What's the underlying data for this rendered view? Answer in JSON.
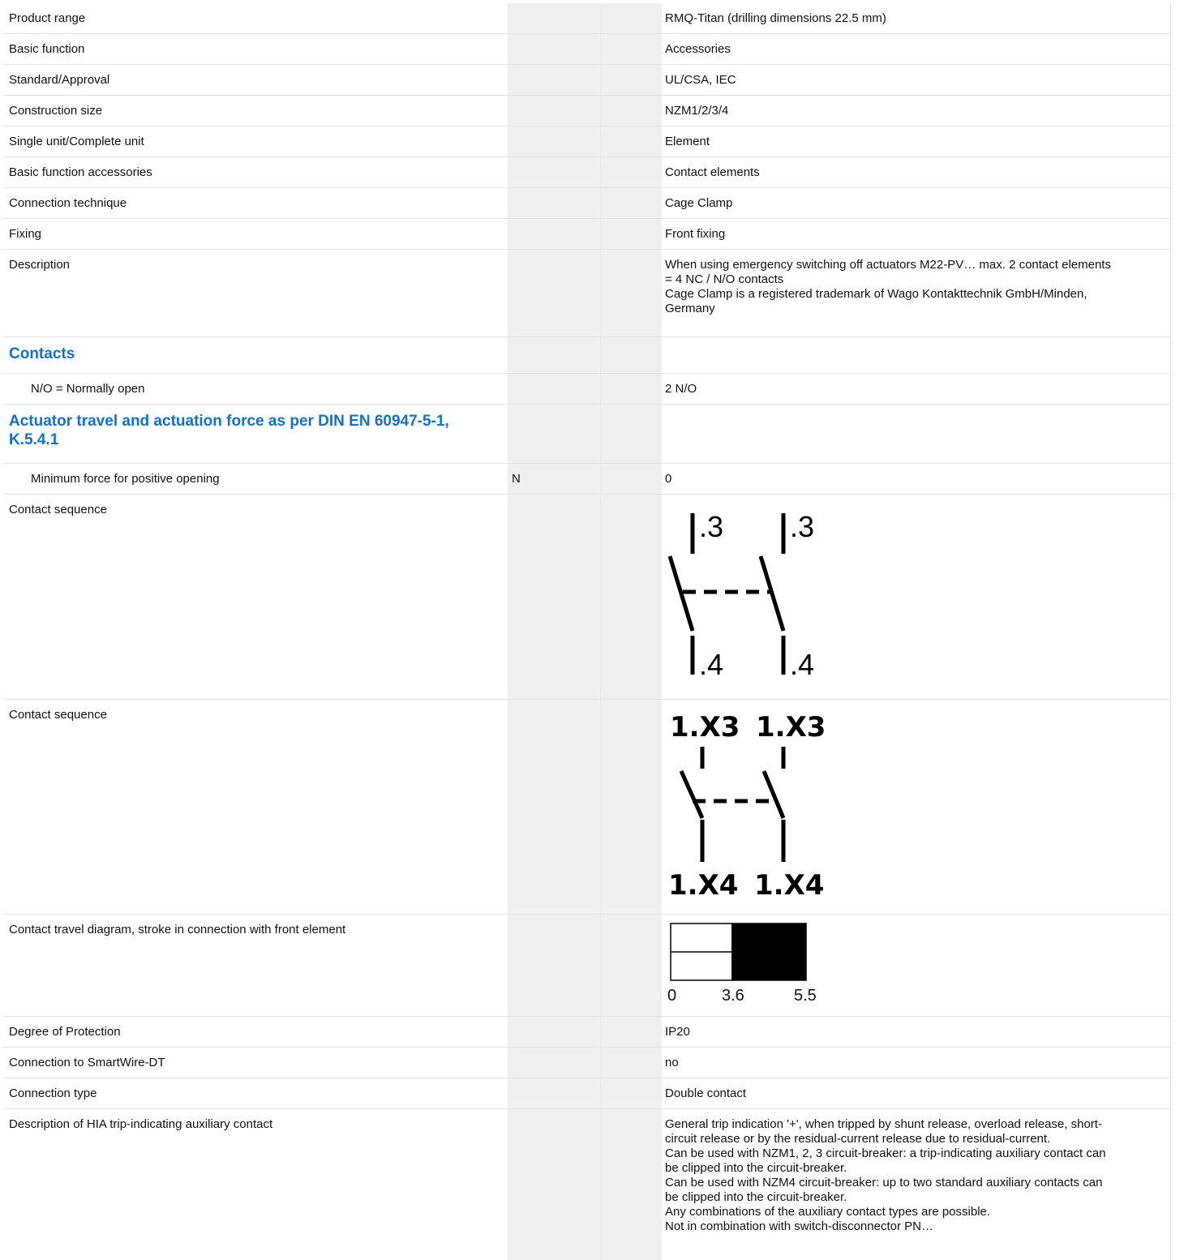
{
  "rows": {
    "product_range": {
      "label": "Product range",
      "unit": "",
      "value": "RMQ-Titan (drilling dimensions 22.5 mm)"
    },
    "basic_function": {
      "label": "Basic function",
      "unit": "",
      "value": "Accessories"
    },
    "standard_approval": {
      "label": "Standard/Approval",
      "unit": "",
      "value": "UL/CSA, IEC"
    },
    "construction_size": {
      "label": "Construction size",
      "unit": "",
      "value": "NZM1/2/3/4"
    },
    "single_complete": {
      "label": "Single unit/Complete unit",
      "unit": "",
      "value": "Element"
    },
    "basic_function_accessories": {
      "label": "Basic function accessories",
      "unit": "",
      "value": "Contact elements"
    },
    "connection_technique": {
      "label": "Connection technique",
      "unit": "",
      "value": "Cage Clamp"
    },
    "fixing": {
      "label": "Fixing",
      "unit": "",
      "value": "Front fixing"
    },
    "description": {
      "label": "Description",
      "lines": [
        "When using emergency switching off actuators M22-PV… max. 2 contact elements",
        "= 4 NC / N/O contacts",
        "Cage Clamp is a registered trademark of Wago Kontakttechnik GmbH/Minden,",
        "Germany"
      ]
    },
    "contacts_heading": {
      "label": "Contacts"
    },
    "no_normally_open": {
      "label": "N/O = Normally open",
      "unit": "",
      "value": "2 N/O"
    },
    "actuator_heading": {
      "label_line1": "Actuator travel and actuation force as per DIN EN 60947-5-1,",
      "label_line2": "K.5.4.1"
    },
    "min_force": {
      "label": "Minimum force for positive opening",
      "unit": "N",
      "value": "0"
    },
    "contact_sequence_1": {
      "label": "Contact sequence",
      "top_label": ".3",
      "bottom_label": ".4"
    },
    "contact_sequence_2": {
      "label": "Contact sequence",
      "top_label": "1.X3",
      "bottom_label": "1.X4"
    },
    "travel_diagram": {
      "label": "Contact travel diagram, stroke in connection with front element",
      "ticks": [
        "0",
        "3.6",
        "5.5"
      ]
    },
    "degree_protection": {
      "label": "Degree of Protection",
      "unit": "",
      "value": "IP20"
    },
    "smartwire": {
      "label": "Connection to SmartWire-DT",
      "unit": "",
      "value": "no"
    },
    "connection_type": {
      "label": "Connection type",
      "unit": "",
      "value": "Double contact"
    },
    "hia_description": {
      "label": "Description of HIA trip-indicating auxiliary contact",
      "lines": [
        "General trip indication '+', when tripped by shunt release, overload release, short-",
        "circuit release or by the residual-current release due to residual-current.",
        "Can be used with NZM1, 2, 3 circuit-breaker: a trip-indicating auxiliary contact can",
        "be clipped into the circuit-breaker.",
        "Can be used with NZM4 circuit-breaker: up to two standard auxiliary contacts can",
        "be clipped into the circuit-breaker.",
        "Any combinations of the auxiliary contact types are possible.",
        "Not in combination with switch-disconnector PN…"
      ]
    }
  }
}
